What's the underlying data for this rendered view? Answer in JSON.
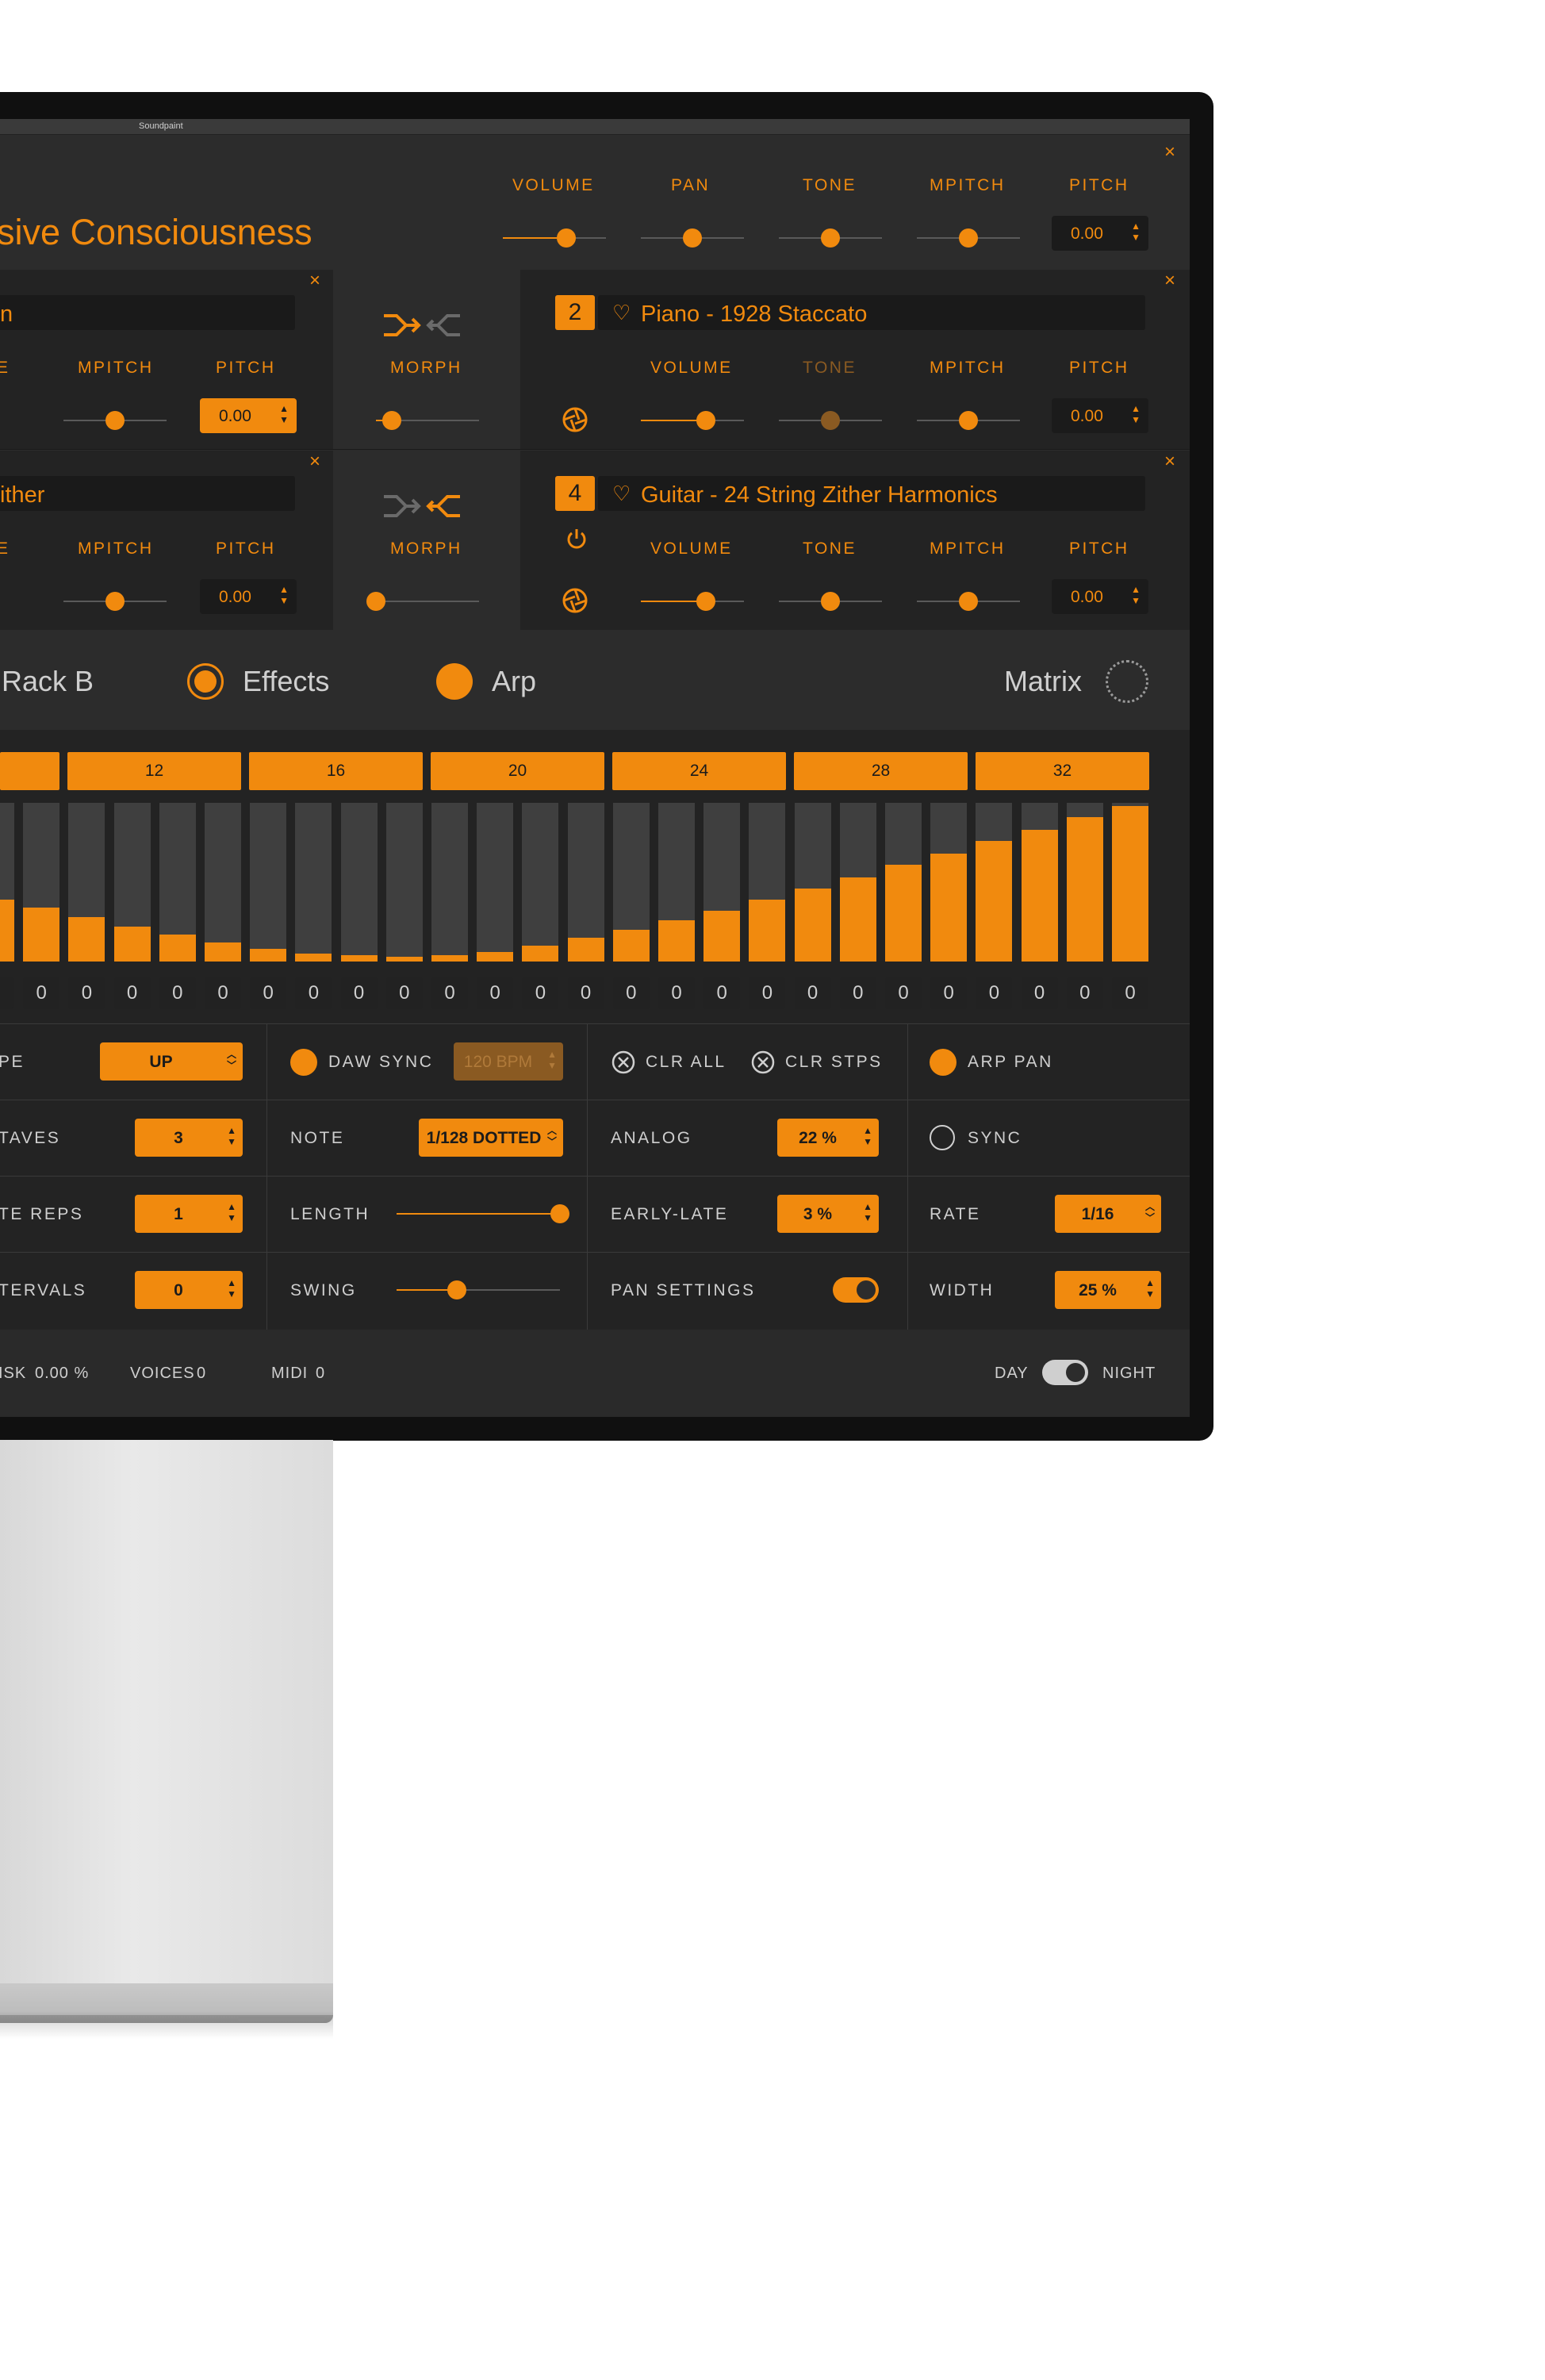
{
  "app": {
    "window_title": "Soundpaint"
  },
  "header": {
    "preset_name": "sive Consciousness",
    "controls": {
      "volume": "VOLUME",
      "pan": "PAN",
      "tone": "TONE",
      "mpitch": "MPITCH",
      "pitch": "PITCH"
    },
    "pitch_value": "0.00",
    "close": "×"
  },
  "layers": {
    "layer1": {
      "name_fragment": "n",
      "mpitch": "MPITCH",
      "pitch": "PITCH",
      "pitch_value": "0.00",
      "morph": "MORPH",
      "close": "×"
    },
    "layer2": {
      "number": "2",
      "name": "Piano - 1928 Staccato",
      "volume": "VOLUME",
      "tone": "TONE",
      "mpitch": "MPITCH",
      "pitch": "PITCH",
      "pitch_value": "0.00",
      "close": "×"
    },
    "layer3": {
      "name_fragment": "ither",
      "mpitch": "MPITCH",
      "pitch": "PITCH",
      "pitch_value": "0.00",
      "morph": "MORPH",
      "close": "×"
    },
    "layer4": {
      "number": "4",
      "name": "Guitar - 24 String Zither Harmonics",
      "volume": "VOLUME",
      "tone": "TONE",
      "mpitch": "MPITCH",
      "pitch": "PITCH",
      "pitch_value": "0.00",
      "close": "×"
    }
  },
  "tabs": {
    "rack_b": "Rack B",
    "effects": "Effects",
    "arp": "Arp",
    "matrix": "Matrix"
  },
  "sequencer": {
    "step_markers": [
      "12",
      "16",
      "20",
      "24",
      "28",
      "32"
    ],
    "step_levels": [
      0.45,
      0.39,
      0.34,
      0.28,
      0.22,
      0.17,
      0.12,
      0.08,
      0.05,
      0.04,
      0.03,
      0.04,
      0.06,
      0.1,
      0.15,
      0.2,
      0.26,
      0.32,
      0.39,
      0.46,
      0.53,
      0.61,
      0.68,
      0.76,
      0.83,
      0.91,
      0.98
    ],
    "step_values": [
      "0",
      "0",
      "0",
      "0",
      "0",
      "0",
      "0",
      "0",
      "0",
      "0",
      "0",
      "0",
      "0",
      "0",
      "0",
      "0",
      "0",
      "0",
      "0",
      "0",
      "0",
      "0",
      "0",
      "0",
      "0",
      "0"
    ]
  },
  "settings": {
    "col1": {
      "type_label": "PE",
      "type_value": "UP",
      "octaves_label": "TAVES",
      "octaves_value": "3",
      "reps_label": "TE REPS",
      "reps_value": "1",
      "intervals_label": "TERVALS",
      "intervals_value": "0"
    },
    "col2": {
      "daw_sync_label": "DAW SYNC",
      "bpm_value": "120 BPM",
      "note_label": "NOTE",
      "note_value": "1/128 DOTTED",
      "length_label": "LENGTH",
      "length_level": 1.0,
      "swing_label": "SWING",
      "swing_level": 0.37
    },
    "col3": {
      "clr_all": "CLR ALL",
      "clr_stps": "CLR STPS",
      "analog_label": "ANALOG",
      "analog_value": "22 %",
      "early_late_label": "EARLY-LATE",
      "early_late_value": "3 %",
      "pan_settings_label": "PAN SETTINGS",
      "pan_settings_on": true
    },
    "col4": {
      "arp_pan_label": "ARP PAN",
      "sync_label": "SYNC",
      "rate_label": "RATE",
      "rate_value": "1/16",
      "width_label": "WIDTH",
      "width_value": "25 %"
    }
  },
  "footer": {
    "disk_label": "ISK",
    "disk_value": "0.00 %",
    "voices_label": "VOICES",
    "voices_value": "0",
    "midi_label": "MIDI",
    "midi_value": "0",
    "day": "DAY",
    "night": "NIGHT"
  },
  "colors": {
    "accent": "#f18a0e",
    "background": "#2c2c2c",
    "panel": "#232323",
    "text_light": "#cfcfcf"
  }
}
